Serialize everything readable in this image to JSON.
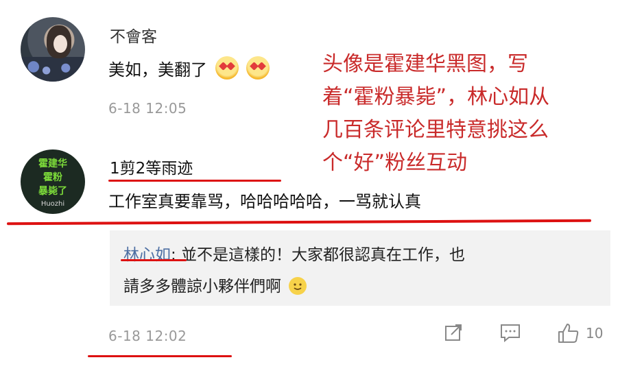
{
  "comments": [
    {
      "user": "不會客",
      "text": "美如，美翻了",
      "time": "6-18 12:05"
    },
    {
      "user": "1剪2等雨迹",
      "text": "工作室真要靠骂，哈哈哈哈哈，一骂就认真",
      "avatar_text": [
        "霍建华",
        "霍粉",
        "暴毙了"
      ],
      "avatar_sub": "Huozhi"
    }
  ],
  "reply": {
    "name": "林心如",
    "line1": ": 並不是這樣的！大家都很認真在工作，也",
    "line2": "請多多體諒小夥伴們啊"
  },
  "footer": {
    "time": "6-18 12:02",
    "like_count": "10"
  },
  "annotation": {
    "lines": [
      "头像是霍建华黑图，写",
      "着“霍粉暴毙”，林心如从",
      "几百条评论里特意挑这么",
      "个“好”粉丝互动"
    ]
  },
  "colors": {
    "annotation_red": "#c92a2a",
    "reply_name_blue": "#4d6fa3",
    "reply_bg": "#f2f2f2"
  },
  "icons": [
    "heart-eyes-emoji-icon",
    "smile-emoji-icon",
    "share-icon",
    "comment-icon",
    "thumbs-up-icon"
  ]
}
